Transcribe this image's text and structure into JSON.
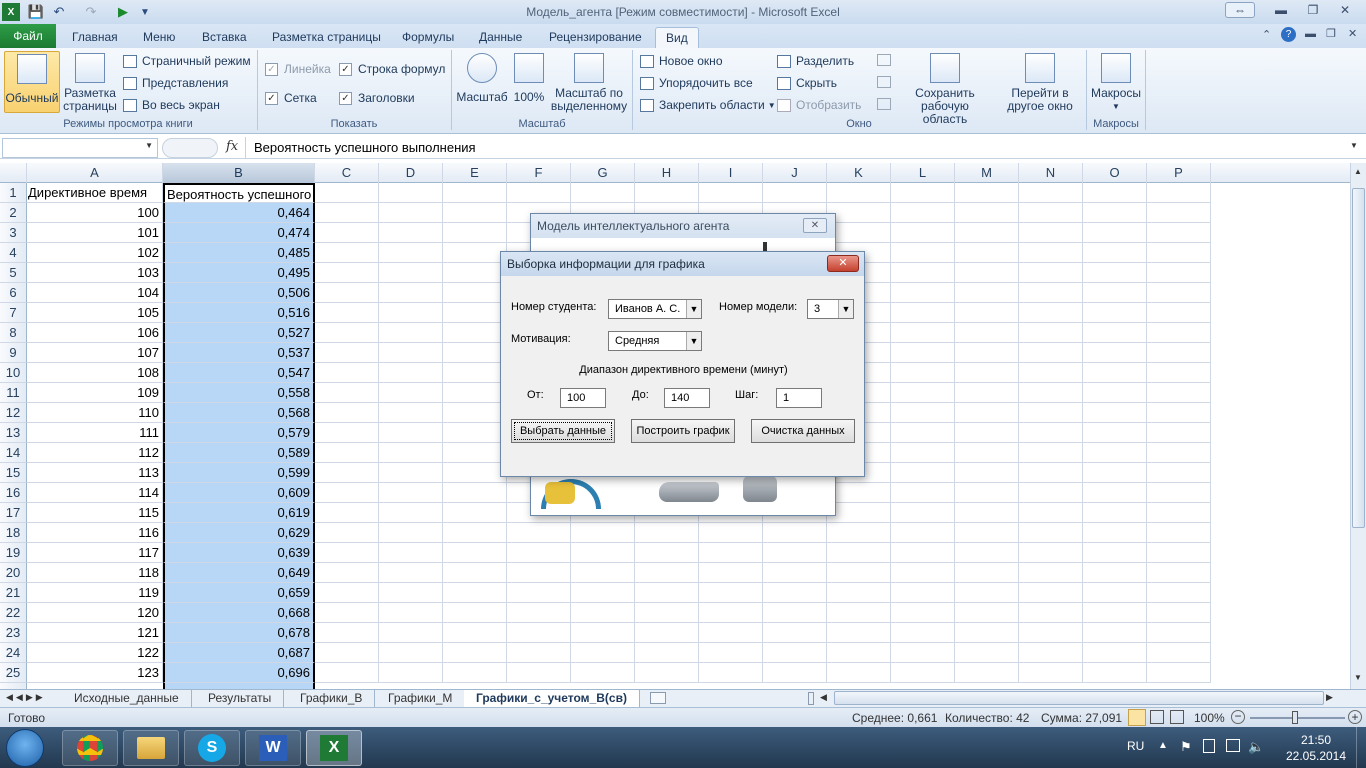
{
  "window": {
    "title": "Модель_агента  [Режим совместимости]  -  Microsoft Excel"
  },
  "tabs": [
    "Файл",
    "Главная",
    "Меню",
    "Вставка",
    "Разметка страницы",
    "Формулы",
    "Данные",
    "Рецензирование",
    "Вид"
  ],
  "ribbon": {
    "views": {
      "normal": "Обычный",
      "page_layout_1": "Разметка",
      "page_layout_2": "страницы",
      "page_mode": "Страничный режим",
      "representations": "Представления",
      "full_screen": "Во весь экран",
      "group": "Режимы просмотра книги"
    },
    "show": {
      "ruler": "Линейка",
      "formula_bar": "Строка формул",
      "grid": "Сетка",
      "headers": "Заголовки",
      "group": "Показать"
    },
    "zoom": {
      "zoom": "Масштаб",
      "hundred": "100%",
      "zoom_sel_1": "Масштаб по",
      "zoom_sel_2": "выделенному",
      "group": "Масштаб"
    },
    "window": {
      "new_window": "Новое окно",
      "arrange_all": "Упорядочить все",
      "freeze": "Закрепить области",
      "split": "Разделить",
      "hide": "Скрыть",
      "unhide": "Отобразить",
      "save_ws_1": "Сохранить",
      "save_ws_2": "рабочую область",
      "switch_1": "Перейти в",
      "switch_2": "другое окно",
      "group": "Окно"
    },
    "macros": {
      "macros": "Макросы",
      "group": "Макросы"
    }
  },
  "formula": {
    "fx": "fx",
    "content": "Вероятность успешного выполнения"
  },
  "columns": [
    "A",
    "B",
    "C",
    "D",
    "E",
    "F",
    "G",
    "H",
    "I",
    "J",
    "K",
    "L",
    "M",
    "N",
    "O",
    "P"
  ],
  "sheet": {
    "header_a": "Директивное время",
    "header_b": "Вероятность успешного выполнения",
    "rows": [
      [
        "100",
        "0,464"
      ],
      [
        "101",
        "0,474"
      ],
      [
        "102",
        "0,485"
      ],
      [
        "103",
        "0,495"
      ],
      [
        "104",
        "0,506"
      ],
      [
        "105",
        "0,516"
      ],
      [
        "106",
        "0,527"
      ],
      [
        "107",
        "0,537"
      ],
      [
        "108",
        "0,547"
      ],
      [
        "109",
        "0,558"
      ],
      [
        "110",
        "0,568"
      ],
      [
        "111",
        "0,579"
      ],
      [
        "112",
        "0,589"
      ],
      [
        "113",
        "0,599"
      ],
      [
        "114",
        "0,609"
      ],
      [
        "115",
        "0,619"
      ],
      [
        "116",
        "0,629"
      ],
      [
        "117",
        "0,639"
      ],
      [
        "118",
        "0,649"
      ],
      [
        "119",
        "0,659"
      ],
      [
        "120",
        "0,668"
      ],
      [
        "121",
        "0,678"
      ],
      [
        "122",
        "0,687"
      ],
      [
        "123",
        "0,696"
      ]
    ],
    "row_numbers": [
      "1",
      "2",
      "3",
      "4",
      "5",
      "6",
      "7",
      "8",
      "9",
      "10",
      "11",
      "12",
      "13",
      "14",
      "15",
      "16",
      "17",
      "18",
      "19",
      "20",
      "21",
      "22",
      "23",
      "24",
      "25"
    ]
  },
  "sheet_tabs": [
    "Исходные_данные",
    "Результаты",
    "Графики_В",
    "Графики_М",
    "Графики_с_учетом_В(св)"
  ],
  "status": {
    "ready": "Готово",
    "average": "Среднее: 0,661",
    "count": "Количество: 42",
    "sum": "Сумма: 27,091",
    "zoom": "100%"
  },
  "taskbar": {
    "lang": "RU",
    "time": "21:50",
    "date": "22.05.2014"
  },
  "back_dialog": {
    "title": "Модель интеллектуального агента"
  },
  "dialog": {
    "title": "Выборка информации для графика",
    "student_label": "Номер студента:",
    "student_value": "Иванов А. С.",
    "model_label": "Номер модели:",
    "model_value": "3",
    "motivation_label": "Мотивация:",
    "motivation_value": "Средняя",
    "range_label": "Диапазон директивного времени (минут)",
    "from_label": "От:",
    "from_value": "100",
    "to_label": "До:",
    "to_value": "140",
    "step_label": "Шаг:",
    "step_value": "1",
    "btn_select": "Выбрать данные",
    "btn_plot": "Построить график",
    "btn_clear": "Очистка данных"
  }
}
